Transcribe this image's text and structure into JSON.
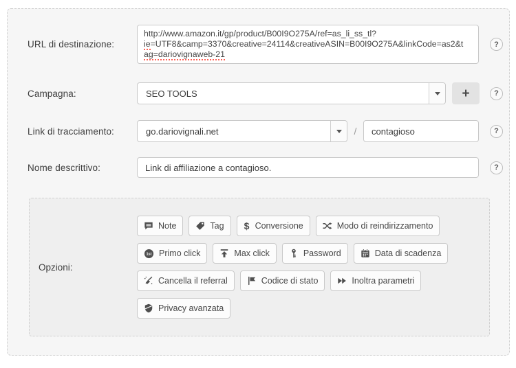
{
  "ui": {
    "help_label": "?"
  },
  "colors": {
    "card_bg": "#f6f6f6",
    "options_bg": "#efefef",
    "dashed_border": "#d2d2d2",
    "input_border": "#c9c9c9",
    "text": "#3d3d3d",
    "icon": "#4f4f4f",
    "spellcheck_red": "#ff5b50"
  },
  "form": {
    "url": {
      "label": "URL di destinazione:",
      "value": "http://www.amazon.it/gp/product/B00I9O275A/ref=as_li_ss_tl?ie=UTF8&camp=3370&creative=24114&creativeASIN=B00I9O275A&linkCode=as2&tag=dariovignaweb-21",
      "line1": "http://www.amazon.it/gp/product/B00I9O275A/ref=as_li_ss_tl?",
      "line2_misspelled": "ie",
      "line2_rest": "=UTF8&camp=3370&creative=24114&creativeASIN=B00I9O275A&linkCode=as2&t",
      "line3_misspelled": "ag=dariovignaweb-21"
    },
    "campaign": {
      "label": "Campagna:",
      "value": "SEO TOOLS",
      "add_button": "+"
    },
    "tracking": {
      "label": "Link di tracciamento:",
      "domain": "go.dariovignali.net",
      "separator": "/",
      "slug": "contagioso"
    },
    "descriptive_name": {
      "label": "Nome descrittivo:",
      "value": "Link di affiliazione a contagioso."
    },
    "options": {
      "label": "Opzioni:",
      "buttons": [
        {
          "label": "Note",
          "icon": "note-icon"
        },
        {
          "label": "Tag",
          "icon": "tag-icon"
        },
        {
          "label": "Conversione",
          "icon": "dollar-icon",
          "glyph": "$"
        },
        {
          "label": "Modo di reindirizzamento",
          "icon": "shuffle-icon"
        },
        {
          "label": "Primo click",
          "icon": "first-click-icon",
          "badge": "1st"
        },
        {
          "label": "Max click",
          "icon": "arrow-top-icon"
        },
        {
          "label": "Password",
          "icon": "key-icon"
        },
        {
          "label": "Data di scadenza",
          "icon": "calendar-icon"
        },
        {
          "label": "Cancella il referral",
          "icon": "broom-icon"
        },
        {
          "label": "Codice di stato",
          "icon": "flag-icon"
        },
        {
          "label": "Inoltra parametri",
          "icon": "fast-forward-icon"
        },
        {
          "label": "Privacy avanzata",
          "icon": "shield-icon"
        }
      ]
    }
  }
}
